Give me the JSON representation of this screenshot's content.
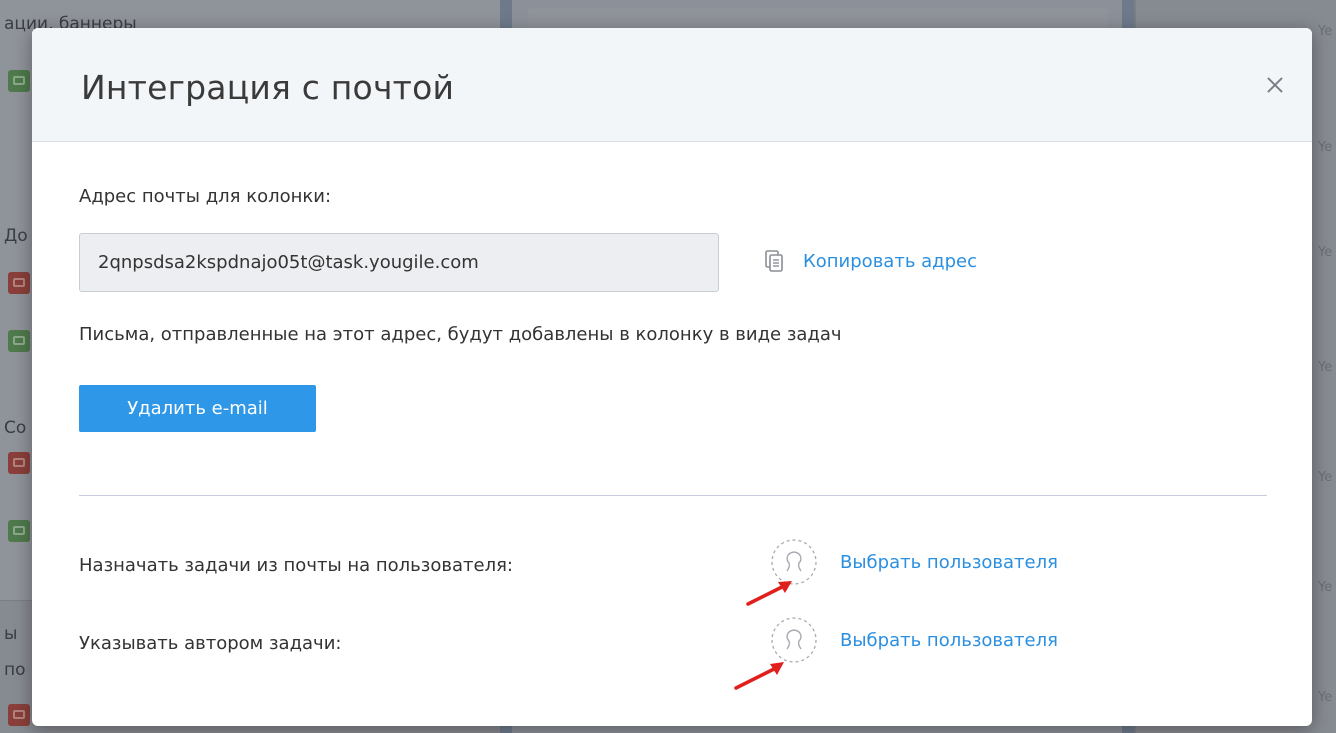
{
  "background": {
    "left_column_texts": [
      "ации, баннеры",
      "До",
      "Со",
      "ы",
      "по"
    ],
    "right_column_texts": [
      "Ye",
      "Ye",
      "Ye",
      "Ye",
      "Ye",
      "Ye",
      "Ye",
      "Ye"
    ]
  },
  "modal": {
    "title": "Интеграция с почтой",
    "close_glyph": "×",
    "email_section_label": "Адрес почты для колонки:",
    "email_value": "2qnpsdsa2kspdnajo05t@task.yougile.com",
    "copy_label": "Копировать адрес",
    "hint_text": "Письма, отправленные на этот адрес, будут добавлены в колонку в виде задач",
    "delete_button_label": "Удалить e-mail",
    "assign_label": "Назначать задачи из почты на пользователя:",
    "author_label": "Указывать автором задачи:",
    "select_user_label": "Выбрать пользователя",
    "select_author_label": "Выбрать пользователя"
  },
  "colors": {
    "accent": "#2f97e8",
    "link": "#2b8fe0",
    "annotation_arrow": "#e0201c"
  },
  "icons": {
    "copy": "copy-icon",
    "user_placeholder": "user-placeholder-icon",
    "close": "close-icon"
  }
}
